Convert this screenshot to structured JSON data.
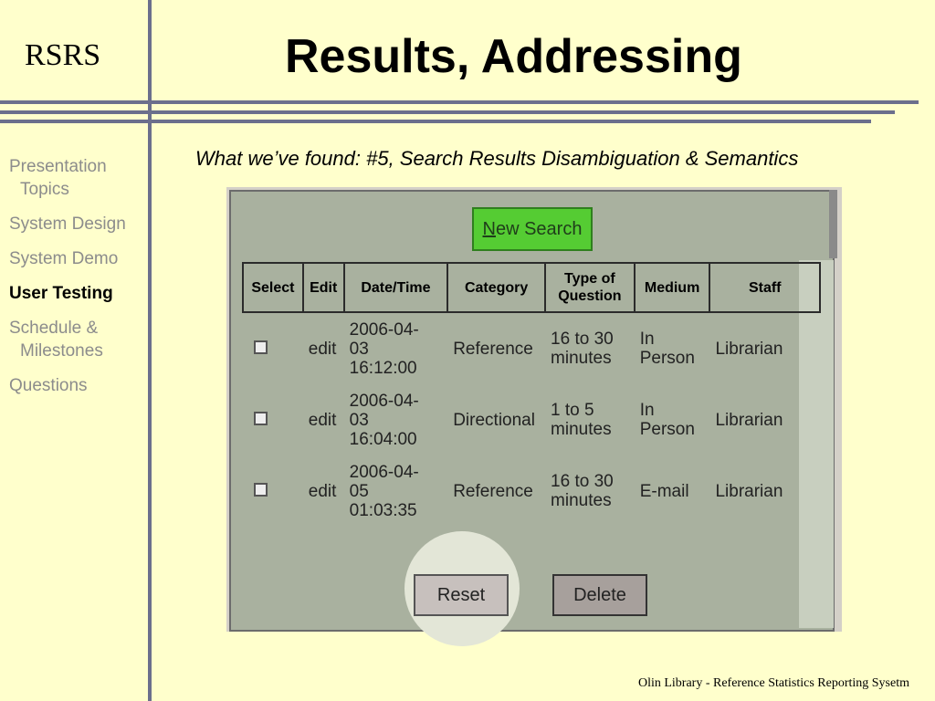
{
  "slide": {
    "logo": "RSRS",
    "title": "Results, Addressing",
    "subtitle": "What we’ve found: #5, Search Results Disambiguation & Semantics",
    "footer": "Olin Library - Reference Statistics Reporting Sysetm"
  },
  "nav": {
    "items": [
      {
        "line1": "Presentation",
        "line2": "Topics",
        "active": false
      },
      {
        "line1": "System Design",
        "active": false
      },
      {
        "line1": "System Demo",
        "active": false
      },
      {
        "line1": "User Testing",
        "active": true
      },
      {
        "line1": "Schedule &",
        "line2": "Milestones",
        "active": false
      },
      {
        "line1": "Questions",
        "active": false
      }
    ]
  },
  "app": {
    "new_search_label": "New Search",
    "new_search_mnemonic": "N",
    "new_search_rest": "ew Search",
    "columns": [
      "Select",
      "Edit",
      "Date/Time",
      "Category",
      "Type of Question",
      "Medium",
      "Staff"
    ],
    "rows": [
      {
        "checked": false,
        "edit": "edit",
        "date1": "2006-04-",
        "date2": "03",
        "date3": "16:12:00",
        "category": "Reference",
        "type1": "16 to 30",
        "type2": "minutes",
        "medium1": "In",
        "medium2": "Person",
        "staff": "Librarian"
      },
      {
        "checked": false,
        "edit": "edit",
        "date1": "2006-04-",
        "date2": "03",
        "date3": "16:04:00",
        "category": "Directional",
        "type1": "1 to 5",
        "type2": "minutes",
        "medium1": "In",
        "medium2": "Person",
        "staff": "Librarian"
      },
      {
        "checked": false,
        "edit": "edit",
        "date1": "2006-04-",
        "date2": "05",
        "date3": "01:03:35",
        "category": "Reference",
        "type1": "16 to 30",
        "type2": "minutes",
        "medium1": "E-mail",
        "medium2": "",
        "staff": "Librarian"
      }
    ],
    "reset_label": "Reset",
    "delete_label": "Delete"
  },
  "colors": {
    "background": "#ffffcc",
    "rule": "#6b6f8c",
    "new_search_bg": "#55cc33",
    "panel_bg": "#a9b19f"
  }
}
